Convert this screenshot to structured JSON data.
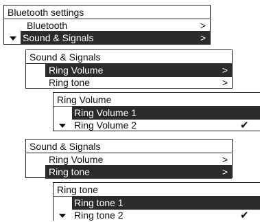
{
  "panel1": {
    "title": "Bluetooth settings",
    "items": [
      {
        "label": "Bluetooth",
        "arrow": ">"
      },
      {
        "label": "Sound & Signals",
        "arrow": ">"
      }
    ]
  },
  "panel2": {
    "title": "Sound & Signals",
    "items": [
      {
        "label": "Ring Volume",
        "arrow": ">"
      },
      {
        "label": "Ring tone",
        "arrow": ">"
      }
    ]
  },
  "panel3": {
    "title": "Ring Volume",
    "items": [
      {
        "label": "Ring Volume 1"
      },
      {
        "label": "Ring Volume 2"
      }
    ],
    "check_glyph": "✔"
  },
  "panel4": {
    "title": "Sound & Signals",
    "items": [
      {
        "label": "Ring Volume",
        "arrow": ">"
      },
      {
        "label": "Ring tone",
        "arrow": ">"
      }
    ]
  },
  "panel5": {
    "title": "Ring tone",
    "items": [
      {
        "label": "Ring tone 1"
      },
      {
        "label": "Ring tone 2"
      }
    ],
    "check_glyph": "✔"
  }
}
